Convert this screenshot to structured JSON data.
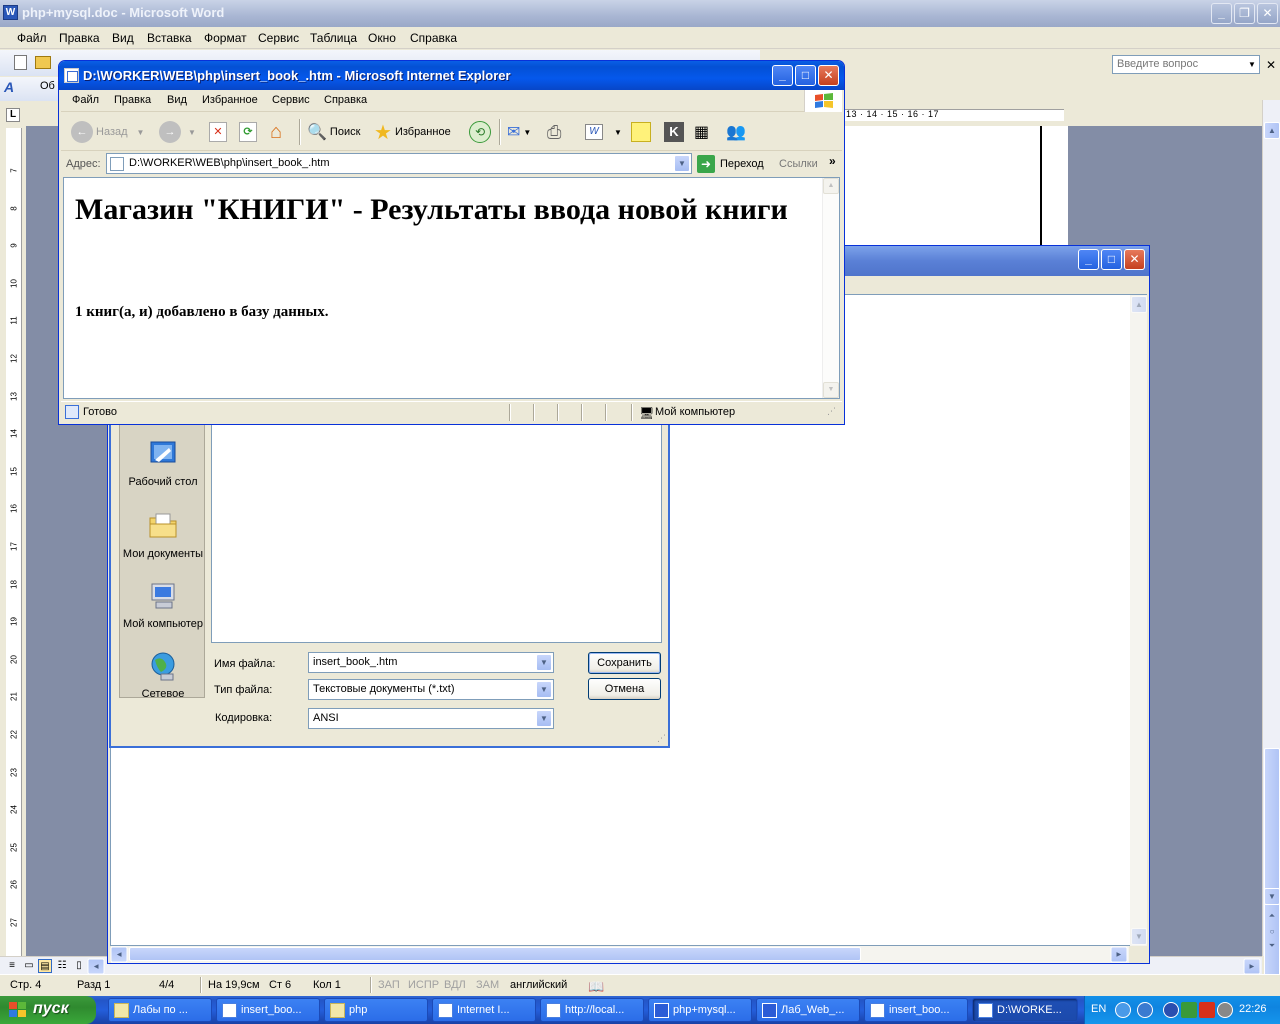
{
  "word": {
    "title": "php+mysql.doc - Microsoft Word",
    "menu": [
      "Файл",
      "Правка",
      "Вид",
      "Вставка",
      "Формат",
      "Сервис",
      "Таблица",
      "Окно",
      "Справка"
    ],
    "ask_placeholder": "Введите вопрос",
    "style_box": "Об",
    "ruler_numbers": "13 · 14 · 15 · 16 · 17",
    "vruler": [
      "7",
      "8",
      "9",
      "10",
      "11",
      "12",
      "13",
      "14",
      "15",
      "16",
      "17",
      "18",
      "19",
      "20",
      "21",
      "22",
      "23",
      "24",
      "25",
      "26",
      "27"
    ],
    "status": {
      "page": "Стр. 4",
      "section": "Разд 1",
      "pages": "4/4",
      "at": "На 19,9см",
      "line": "Ст 6",
      "col": "Кол 1",
      "rec": "ЗАП",
      "trk": "ИСПР",
      "ext": "ВДЛ",
      "ovr": "ЗАМ",
      "language": "английский"
    }
  },
  "save_dialog": {
    "places": [
      "Рабочий стол",
      "Мои документы",
      "Мой компьютер",
      "Сетевое"
    ],
    "filename_label": "Имя файла:",
    "filename_value": "insert_book_.htm",
    "filetype_label": "Тип файла:",
    "filetype_value": "Текстовые документы (*.txt)",
    "encoding_label": "Кодировка:",
    "encoding_value": "ANSI",
    "save_button": "Сохранить",
    "cancel_button": "Отмена"
  },
  "ie": {
    "title": "D:\\WORKER\\WEB\\php\\insert_book_.htm - Microsoft Internet Explorer",
    "menu": [
      "Файл",
      "Правка",
      "Вид",
      "Избранное",
      "Сервис",
      "Справка"
    ],
    "toolbar": {
      "back": "Назад",
      "search": "Поиск",
      "favorites": "Избранное"
    },
    "address_label": "Адрес:",
    "address_value": "D:\\WORKER\\WEB\\php\\insert_book_.htm",
    "go": "Переход",
    "links": "Ссылки",
    "page": {
      "heading": "Магазин \"КНИГИ\" - Результаты ввода новой книги",
      "message": "1 книг(а, и) добавлено в базу данных."
    },
    "status_left": "Готово",
    "status_zone": "Мой компьютер"
  },
  "taskbar": {
    "start": "пуск",
    "tasks": [
      "Лабы по ...",
      "insert_boo...",
      "php",
      "Internet I...",
      "http://local...",
      "php+mysql...",
      "Лаб_Web_...",
      "insert_boo...",
      "D:\\WORKE..."
    ],
    "lang": "EN",
    "clock": "22:26"
  },
  "colors": {
    "xp_blue": "#0558ec",
    "inactive_title": "#a9b6d3",
    "doc_bg": "#838da6",
    "start_green": "#3aa83a"
  }
}
